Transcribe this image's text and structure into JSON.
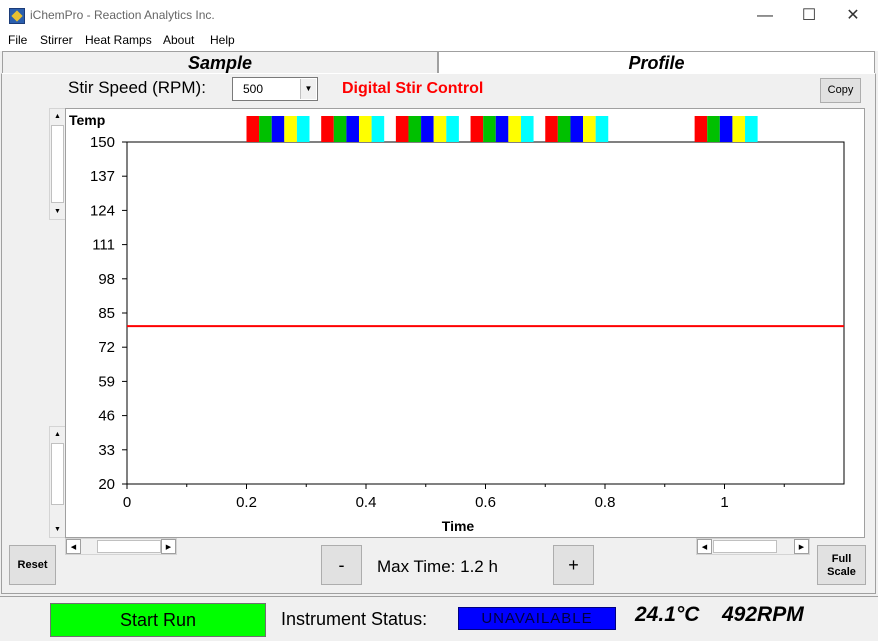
{
  "window": {
    "title": "iChemPro - Reaction Analytics Inc.",
    "minimize": "—",
    "maximize": "☐",
    "close": "✕"
  },
  "menu": [
    "File",
    "Stirrer",
    "Heat Ramps",
    "About",
    "Help"
  ],
  "tabs": [
    {
      "label": "Sample",
      "active": false
    },
    {
      "label": "Profile",
      "active": true
    }
  ],
  "stir": {
    "label": "Stir Speed (RPM):",
    "value": "500",
    "digital_label": "Digital Stir Control",
    "digital_color": "#ff0000"
  },
  "copy_label": "Copy",
  "reset_label": "Reset",
  "minus_label": "-",
  "plus_label": "+",
  "max_time_label": "Max Time: 1.2 h",
  "fullscale_label": [
    "Full",
    "Scale"
  ],
  "start_label": "Start Run",
  "start_color": "#00ff00",
  "status": {
    "label": "Instrument Status:",
    "value": "UNAVAILABLE",
    "color": "#0000ff"
  },
  "readouts": {
    "temp": "24.1°C",
    "rpm": "492RPM"
  },
  "color_strips": {
    "pattern": [
      "#ff0000",
      "#00c000",
      "#0000ff",
      "#ffff00",
      "#00ffff"
    ],
    "groups_at_time": [
      0.2,
      0.325,
      0.45,
      0.575,
      0.7,
      0.95
    ]
  },
  "chart_data": {
    "type": "line",
    "ylabel": "Temp",
    "xlabel": "Time",
    "yticks": [
      150,
      137,
      124,
      111,
      98,
      85,
      72,
      59,
      46,
      33,
      20
    ],
    "xticks": [
      0,
      0.2,
      0.4,
      0.6,
      0.8,
      1
    ],
    "xlim": [
      0,
      1.2
    ],
    "ylim": [
      20,
      150
    ],
    "series": [
      {
        "color": "#ff0000",
        "x": [
          0,
          1.2
        ],
        "y": [
          80,
          80
        ]
      }
    ]
  }
}
